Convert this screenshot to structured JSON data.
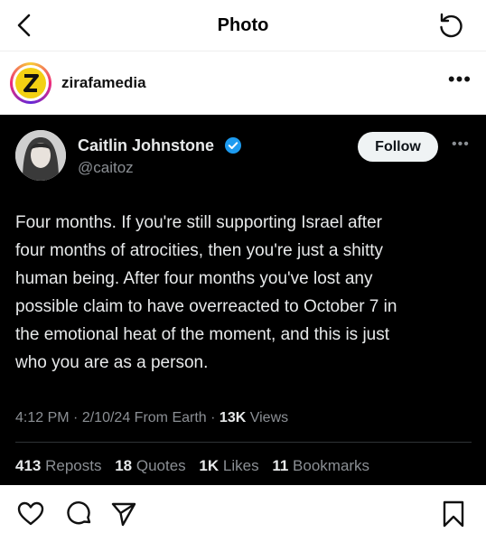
{
  "topbar": {
    "title": "Photo",
    "back_icon": "chevron-left-icon",
    "refresh_icon": "refresh-icon"
  },
  "post": {
    "username": "zirafamedia",
    "more_icon": "more-horizontal-icon"
  },
  "tweet": {
    "name": "Caitlin Johnstone",
    "handle": "@caitoz",
    "follow_label": "Follow",
    "body_lines": [
      "Four months. If you're still supporting Israel after",
      "four months of atrocities, then you're just a shitty",
      "human being. After four months you've lost any",
      "possible claim to have overreacted to October 7 in",
      "the emotional heat of the moment, and this is just",
      "who you are as a person."
    ],
    "time": "4:12 PM",
    "date": "2/10/24",
    "source": "From Earth",
    "views_count": "13K",
    "views_label": "Views",
    "reposts_count": "413",
    "reposts_label": "Reposts",
    "quotes_count": "18",
    "quotes_label": "Quotes",
    "likes_count": "1K",
    "likes_label": "Likes",
    "bookmarks_count": "11",
    "bookmarks_label": "Bookmarks",
    "verified_color": "#1d9bf0"
  },
  "actions": {
    "like_icon": "heart-icon",
    "comment_icon": "comment-icon",
    "share_icon": "send-icon",
    "save_icon": "bookmark-icon"
  }
}
